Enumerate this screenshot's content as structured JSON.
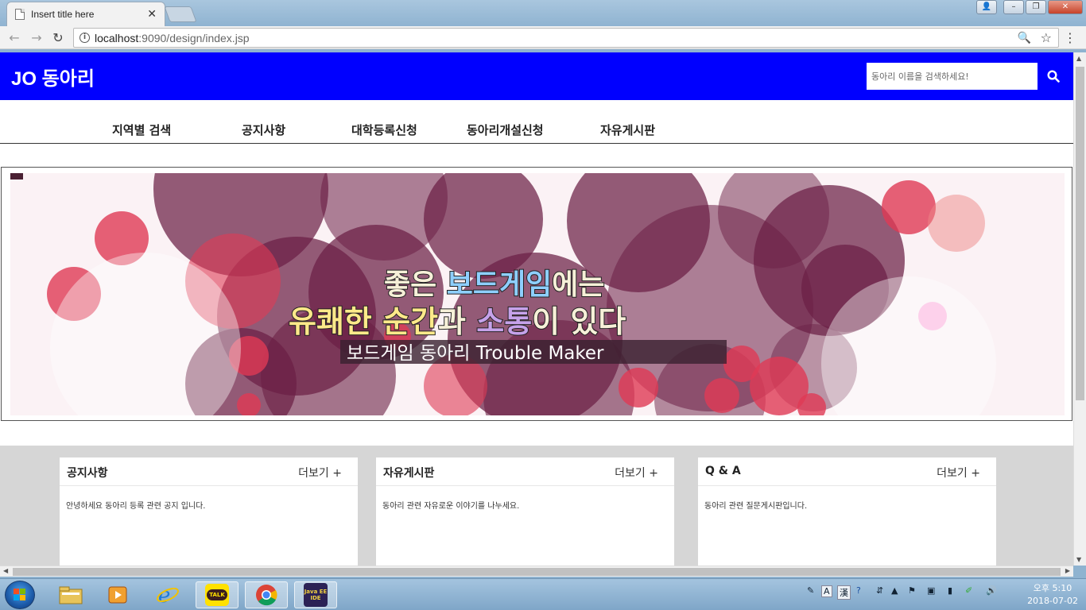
{
  "browser": {
    "tab_title": "Insert title here",
    "tab_close": "✕",
    "url_host": "localhost",
    "url_rest": ":9090/design/index.jsp"
  },
  "site": {
    "logo": "JO 동아리",
    "search_placeholder": "동아리 이름을 검색하세요!",
    "nav": [
      "지역별 검색",
      "공지사항",
      "대학등록신청",
      "동아리개설신청",
      "자유게시판"
    ]
  },
  "banner": {
    "line1_a": "좋은 ",
    "line1_b": "보드게임",
    "line1_c": "에는",
    "line2_a": "유쾌한 ",
    "line2_b": "순간",
    "line2_c": "과 ",
    "line2_d": "소통",
    "line2_e": "이 있다",
    "subtitle": "보드게임 동아리 Trouble Maker"
  },
  "boards": [
    {
      "title": "공지사항",
      "more": "더보기 +",
      "body": "안녕하세요 동아리 등록 관련 공지 입니다."
    },
    {
      "title": "자유게시판",
      "more": "더보기 +",
      "body": "동아리 관련 자유로운 이야기를 나누세요."
    },
    {
      "title": "Q & A",
      "more": "더보기 +",
      "body": "동아리 관련 질문게시판입니다."
    }
  ],
  "taskbar": {
    "kakao_label": "TALK",
    "javaee_label": "Java EE IDE",
    "tray_lang_a": "A",
    "tray_lang_b": "漢",
    "clock_time": "오후 5:10",
    "clock_date": "2018-07-02"
  },
  "colors": {
    "header_blue": "#0000ff",
    "board_bg": "#d6d6d6",
    "bubble": "#8b2d55"
  }
}
